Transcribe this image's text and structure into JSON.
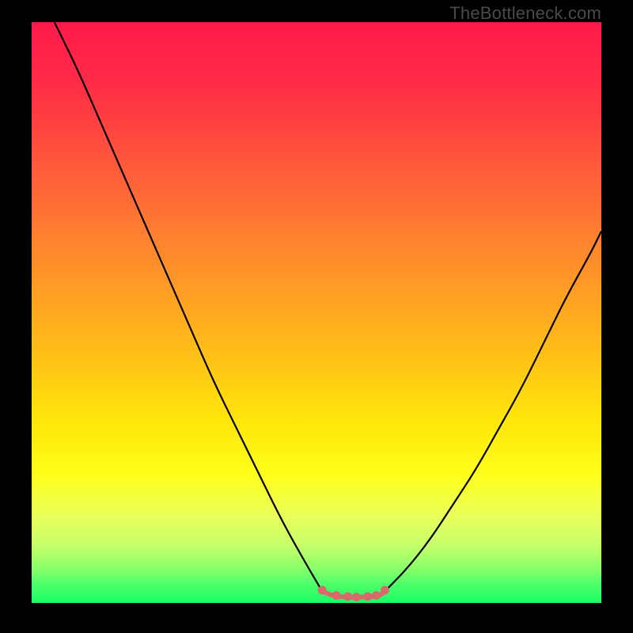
{
  "watermark": "TheBottleneck.com",
  "chart_data": {
    "type": "line",
    "title": "",
    "xlabel": "",
    "ylabel": "",
    "xlim": [
      0,
      100
    ],
    "ylim": [
      0,
      100
    ],
    "series": [
      {
        "name": "curve-left",
        "x": [
          4,
          8,
          12,
          16,
          20,
          24,
          28,
          32,
          36,
          40,
          44,
          48,
          51
        ],
        "y": [
          100,
          92,
          83,
          74,
          65,
          56,
          47,
          38,
          30,
          22,
          14,
          7,
          2
        ]
      },
      {
        "name": "flat-bottom",
        "x": [
          51,
          53,
          55,
          57,
          59,
          61,
          62
        ],
        "y": [
          2,
          1.2,
          1,
          1,
          1,
          1.2,
          2
        ]
      },
      {
        "name": "curve-right",
        "x": [
          62,
          66,
          70,
          74,
          78,
          82,
          86,
          90,
          94,
          98,
          100
        ],
        "y": [
          2,
          6,
          11,
          17,
          23,
          30,
          37,
          45,
          53,
          60,
          64
        ]
      },
      {
        "name": "bottom-markers",
        "x": [
          51,
          53.5,
          55.5,
          57,
          59,
          60.5,
          62
        ],
        "y": [
          2.2,
          1.3,
          1.1,
          1.0,
          1.1,
          1.3,
          2.2
        ]
      }
    ],
    "colors": {
      "curve": "#000000",
      "marker": "#d96a6a"
    }
  }
}
